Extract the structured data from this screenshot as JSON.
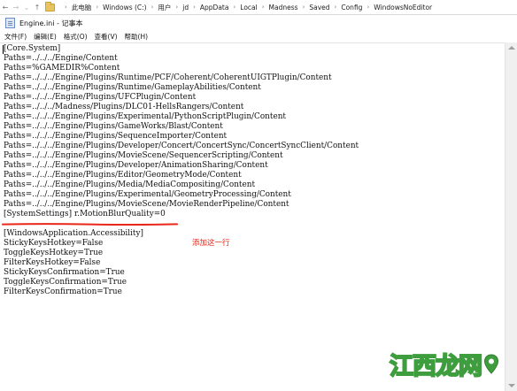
{
  "address_bar": {
    "back_glyph": "←",
    "forward_glyph": "→",
    "up_glyph": "↑",
    "crumbs": [
      "此电脑",
      "Windows (C:)",
      "用户",
      "jd",
      "AppData",
      "Local",
      "Madness",
      "Saved",
      "Config",
      "WindowsNoEditor"
    ],
    "separator": "›"
  },
  "window": {
    "title": "Engine.ini - 记事本"
  },
  "menu": {
    "items": [
      "文件(F)",
      "编辑(E)",
      "格式(O)",
      "查看(V)",
      "帮助(H)"
    ]
  },
  "editor": {
    "lines": [
      "[Core.System]",
      "Paths=../../../Engine/Content",
      "Paths=%GAMEDIR%Content",
      "Paths=../../../Engine/Plugins/Runtime/PCF/Coherent/CoherentUIGTPlugin/Content",
      "Paths=../../../Engine/Plugins/Runtime/GameplayAbilities/Content",
      "Paths=../../../Engine/Plugins/UFCPlugin/Content",
      "Paths=../../../Madness/Plugins/DLC01-HellsRangers/Content",
      "Paths=../../../Engine/Plugins/Experimental/PythonScriptPlugin/Content",
      "Paths=../../../Engine/Plugins/GameWorks/Blast/Content",
      "Paths=../../../Engine/Plugins/SequenceImporter/Content",
      "Paths=../../../Engine/Plugins/Developer/Concert/ConcertSync/ConcertSyncClient/Content",
      "Paths=../../../Engine/Plugins/MovieScene/SequencerScripting/Content",
      "Paths=../../../Engine/Plugins/Developer/AnimationSharing/Content",
      "Paths=../../../Engine/Plugins/Editor/GeometryMode/Content",
      "Paths=../../../Engine/Plugins/Media/MediaCompositing/Content",
      "Paths=../../../Engine/Plugins/Experimental/GeometryProcessing/Content",
      "Paths=../../../Engine/Plugins/MovieScene/MovieRenderPipeline/Content",
      "[SystemSettings] r.MotionBlurQuality=0",
      "",
      "[WindowsApplication.Accessibility]",
      "StickyKeysHotkey=False",
      "ToggleKeysHotkey=True",
      "FilterKeysHotkey=False",
      "StickyKeysConfirmation=True",
      "ToggleKeysConfirmation=True",
      "FilterKeysConfirmation=True"
    ],
    "annotation": "添加这一行",
    "annotation_color": "#e8261a"
  },
  "watermark": {
    "text": "江西龙网",
    "color": "#3e9e3e"
  }
}
